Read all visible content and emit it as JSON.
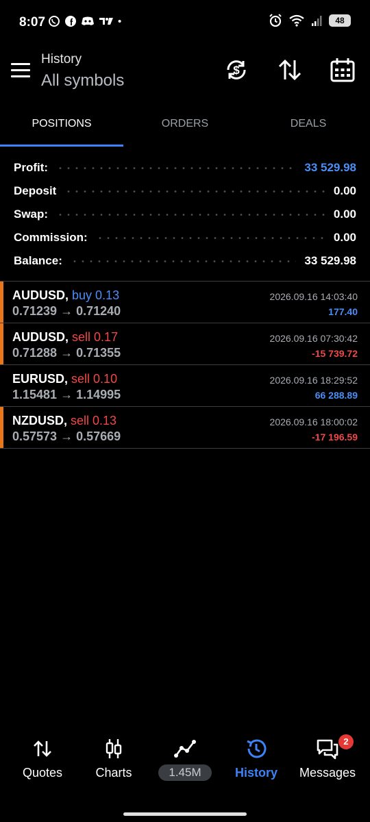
{
  "status": {
    "time": "8:07",
    "notif_icons": [
      "whatsapp-icon",
      "facebook-icon",
      "discord-icon",
      "tradingview-icon"
    ],
    "battery": "48"
  },
  "header": {
    "subtitle": "History",
    "title": "All symbols",
    "icons": [
      "currency-refresh-icon",
      "sort-icon",
      "calendar-icon"
    ]
  },
  "tabs": [
    {
      "label": "POSITIONS",
      "active": true
    },
    {
      "label": "ORDERS",
      "active": false
    },
    {
      "label": "DEALS",
      "active": false
    }
  ],
  "summary": {
    "profit_label": "Profit:",
    "profit_value": "33 529.98",
    "deposit_label": "Deposit",
    "deposit_value": "0.00",
    "swap_label": "Swap:",
    "swap_value": "0.00",
    "commission_label": "Commission:",
    "commission_value": "0.00",
    "balance_label": "Balance:",
    "balance_value": "33 529.98"
  },
  "positions": [
    {
      "symbol": "AUDUSD,",
      "side": "buy 0.13",
      "prices": "0.71239 → 0.71240",
      "date": "2026.09.16 14:03:40",
      "pl": "177.40"
    },
    {
      "symbol": "AUDUSD,",
      "side": "sell 0.17",
      "prices": "0.71288 → 0.71355",
      "date": "2026.09.16 07:30:42",
      "pl": "-15 739.72"
    },
    {
      "symbol": "EURUSD,",
      "side": "sell 0.10",
      "prices": "1.15481 → 1.14995",
      "date": "2026.09.16 18:29:52",
      "pl": "66 288.89"
    },
    {
      "symbol": "NZDUSD,",
      "side": "sell 0.13",
      "prices": "0.57573 → 0.57669",
      "date": "2026.09.16 18:00:02",
      "pl": "-17 196.59"
    }
  ],
  "nav": {
    "quotes": "Quotes",
    "charts": "Charts",
    "trade_pill": "1.45M",
    "history": "History",
    "messages": "Messages",
    "messages_badge": "2"
  },
  "colors": {
    "accent": "#3d82f6",
    "profit": "#4a8ff7",
    "loss": "#f04848",
    "position_marker": "#e8761a"
  }
}
